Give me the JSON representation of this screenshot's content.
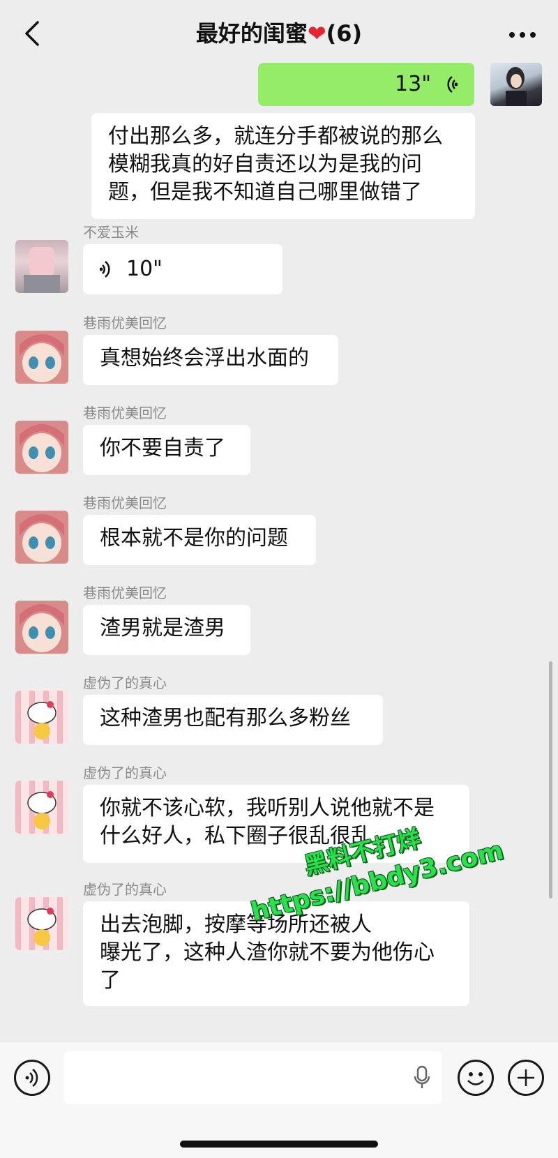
{
  "header": {
    "title": "最好的闺蜜",
    "member_count": "(6)",
    "back_icon": "chevron-left-icon",
    "more_icon": "more-dots-icon"
  },
  "messages": [
    {
      "type": "voice",
      "side": "right",
      "duration": "13\""
    },
    {
      "type": "text",
      "side": "right",
      "lines": [
        "付出那么多，就连分手都被说的那么",
        "模糊我真的好自责还以为是我的问",
        "题，但是我不知道自己哪里做错了"
      ]
    },
    {
      "type": "voice",
      "side": "left",
      "sender": "不爱玉米",
      "duration": "10\""
    },
    {
      "type": "text",
      "side": "left",
      "sender": "巷雨优美回忆",
      "text": "真想始终会浮出水面的"
    },
    {
      "type": "text",
      "side": "left",
      "sender": "巷雨优美回忆",
      "text": "你不要自责了"
    },
    {
      "type": "text",
      "side": "left",
      "sender": "巷雨优美回忆",
      "text": "根本就不是你的问题"
    },
    {
      "type": "text",
      "side": "left",
      "sender": "巷雨优美回忆",
      "text": "渣男就是渣男"
    },
    {
      "type": "text",
      "side": "left",
      "sender": "虚伪了的真心",
      "text": "这种渣男也配有那么多粉丝"
    },
    {
      "type": "text",
      "side": "left",
      "sender": "虚伪了的真心",
      "lines": [
        "你就不该心软，我听别人说他就不是",
        "什么好人，私下圈子很乱很乱"
      ]
    },
    {
      "type": "text",
      "side": "left",
      "sender": "虚伪了的真心",
      "lines": [
        "出去泡脚，按摩等场所还被人",
        "曝光了，这种人渣你就不要为他伤心",
        "了"
      ]
    }
  ],
  "watermark": {
    "line1": "黑料不打烊",
    "line2": "https://bbdy3.com"
  },
  "colors": {
    "self_bubble": "#95ec69",
    "other_bubble": "#ffffff",
    "background": "#ededed",
    "heart": "#e8222e"
  },
  "bottom_bar": {
    "voice_icon": "voice-toggle-icon",
    "emoji_icon": "emoji-icon",
    "plus_icon": "plus-icon",
    "mic_icon": "microphone-icon"
  }
}
